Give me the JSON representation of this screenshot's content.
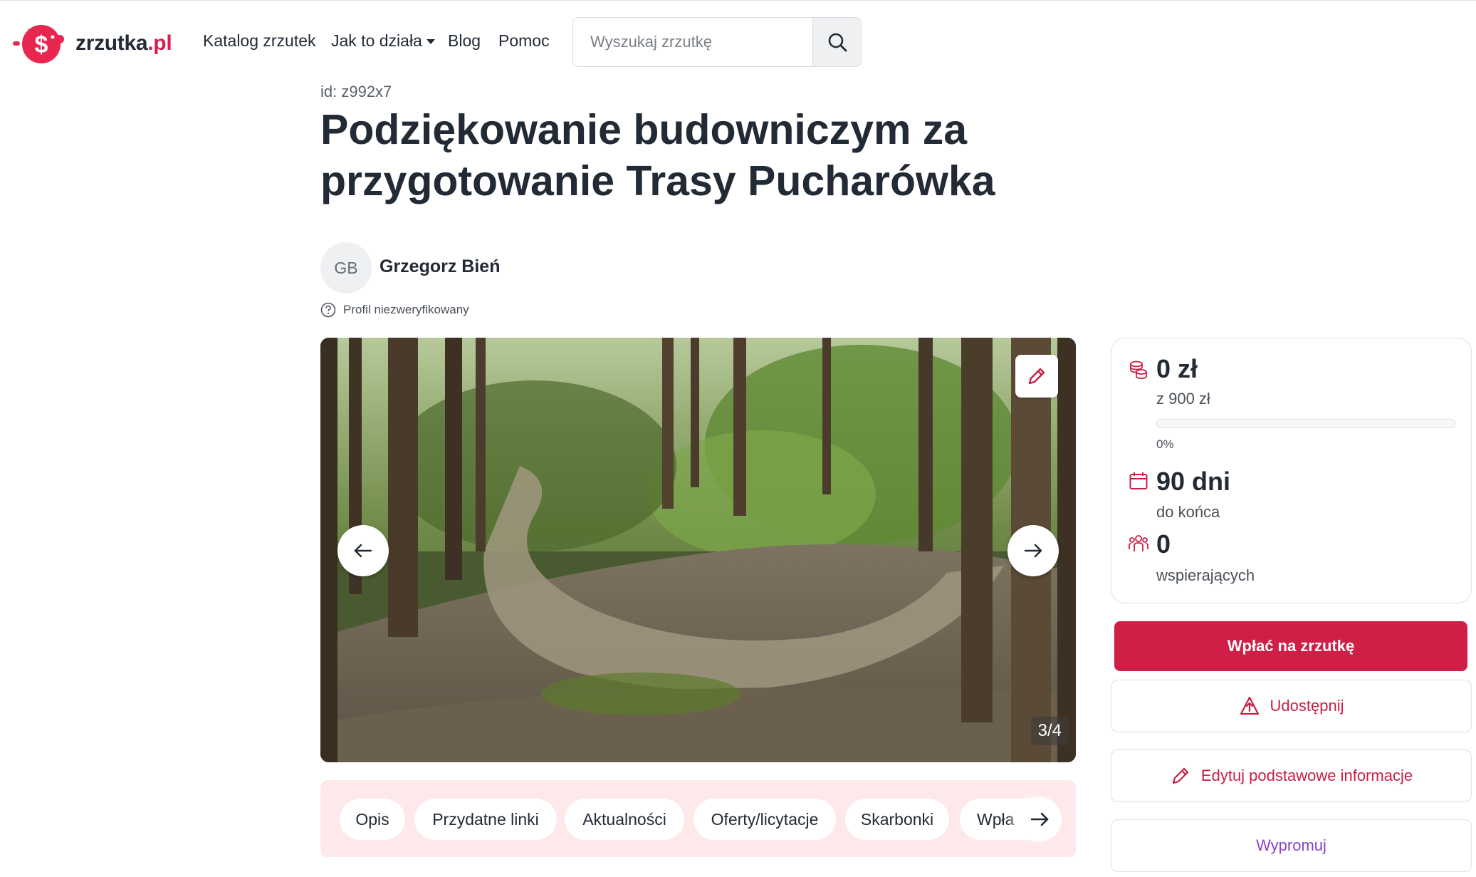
{
  "brand": {
    "name": "zrzutka",
    "tld": ".pl",
    "accent_color": "#d4204d"
  },
  "nav": {
    "items": [
      {
        "label": "Katalog zrzutek"
      },
      {
        "label": "Jak to działa",
        "has_dropdown": true
      },
      {
        "label": "Blog"
      },
      {
        "label": "Pomoc"
      }
    ]
  },
  "search": {
    "placeholder": "Wyszukaj zrzutkę",
    "icon": "search-icon"
  },
  "campaign": {
    "id_text": "id: z992x7",
    "title": "Podziękowanie budowniczym za przygotowanie Trasy Pucharówka",
    "organizer": {
      "initials": "GB",
      "name": "Grzegorz Bień",
      "verification": "Profil niezweryfikowany"
    }
  },
  "gallery": {
    "counter": "3/4",
    "current": 3,
    "total": 4
  },
  "tabs": {
    "items": [
      "Opis",
      "Przydatne linki",
      "Aktualności",
      "Oferty/licytacje",
      "Skarbonki",
      "Wpła"
    ]
  },
  "stats": {
    "raised": "0 zł",
    "goal": "z 900 zł",
    "progress_percent": 0,
    "progress_label": "0%",
    "days": "90 dni",
    "days_label": "do końca",
    "supporters": "0",
    "supporters_label": "wspierających"
  },
  "actions": {
    "pay": "Wpłać na zrzutkę",
    "share": "Udostępnij",
    "edit": "Edytuj podstawowe informacje",
    "promote": "Wypromuj"
  },
  "colors": {
    "primary": "#cf1f47",
    "tabs_background": "#fde8ea",
    "promote": "#8a43c9"
  }
}
